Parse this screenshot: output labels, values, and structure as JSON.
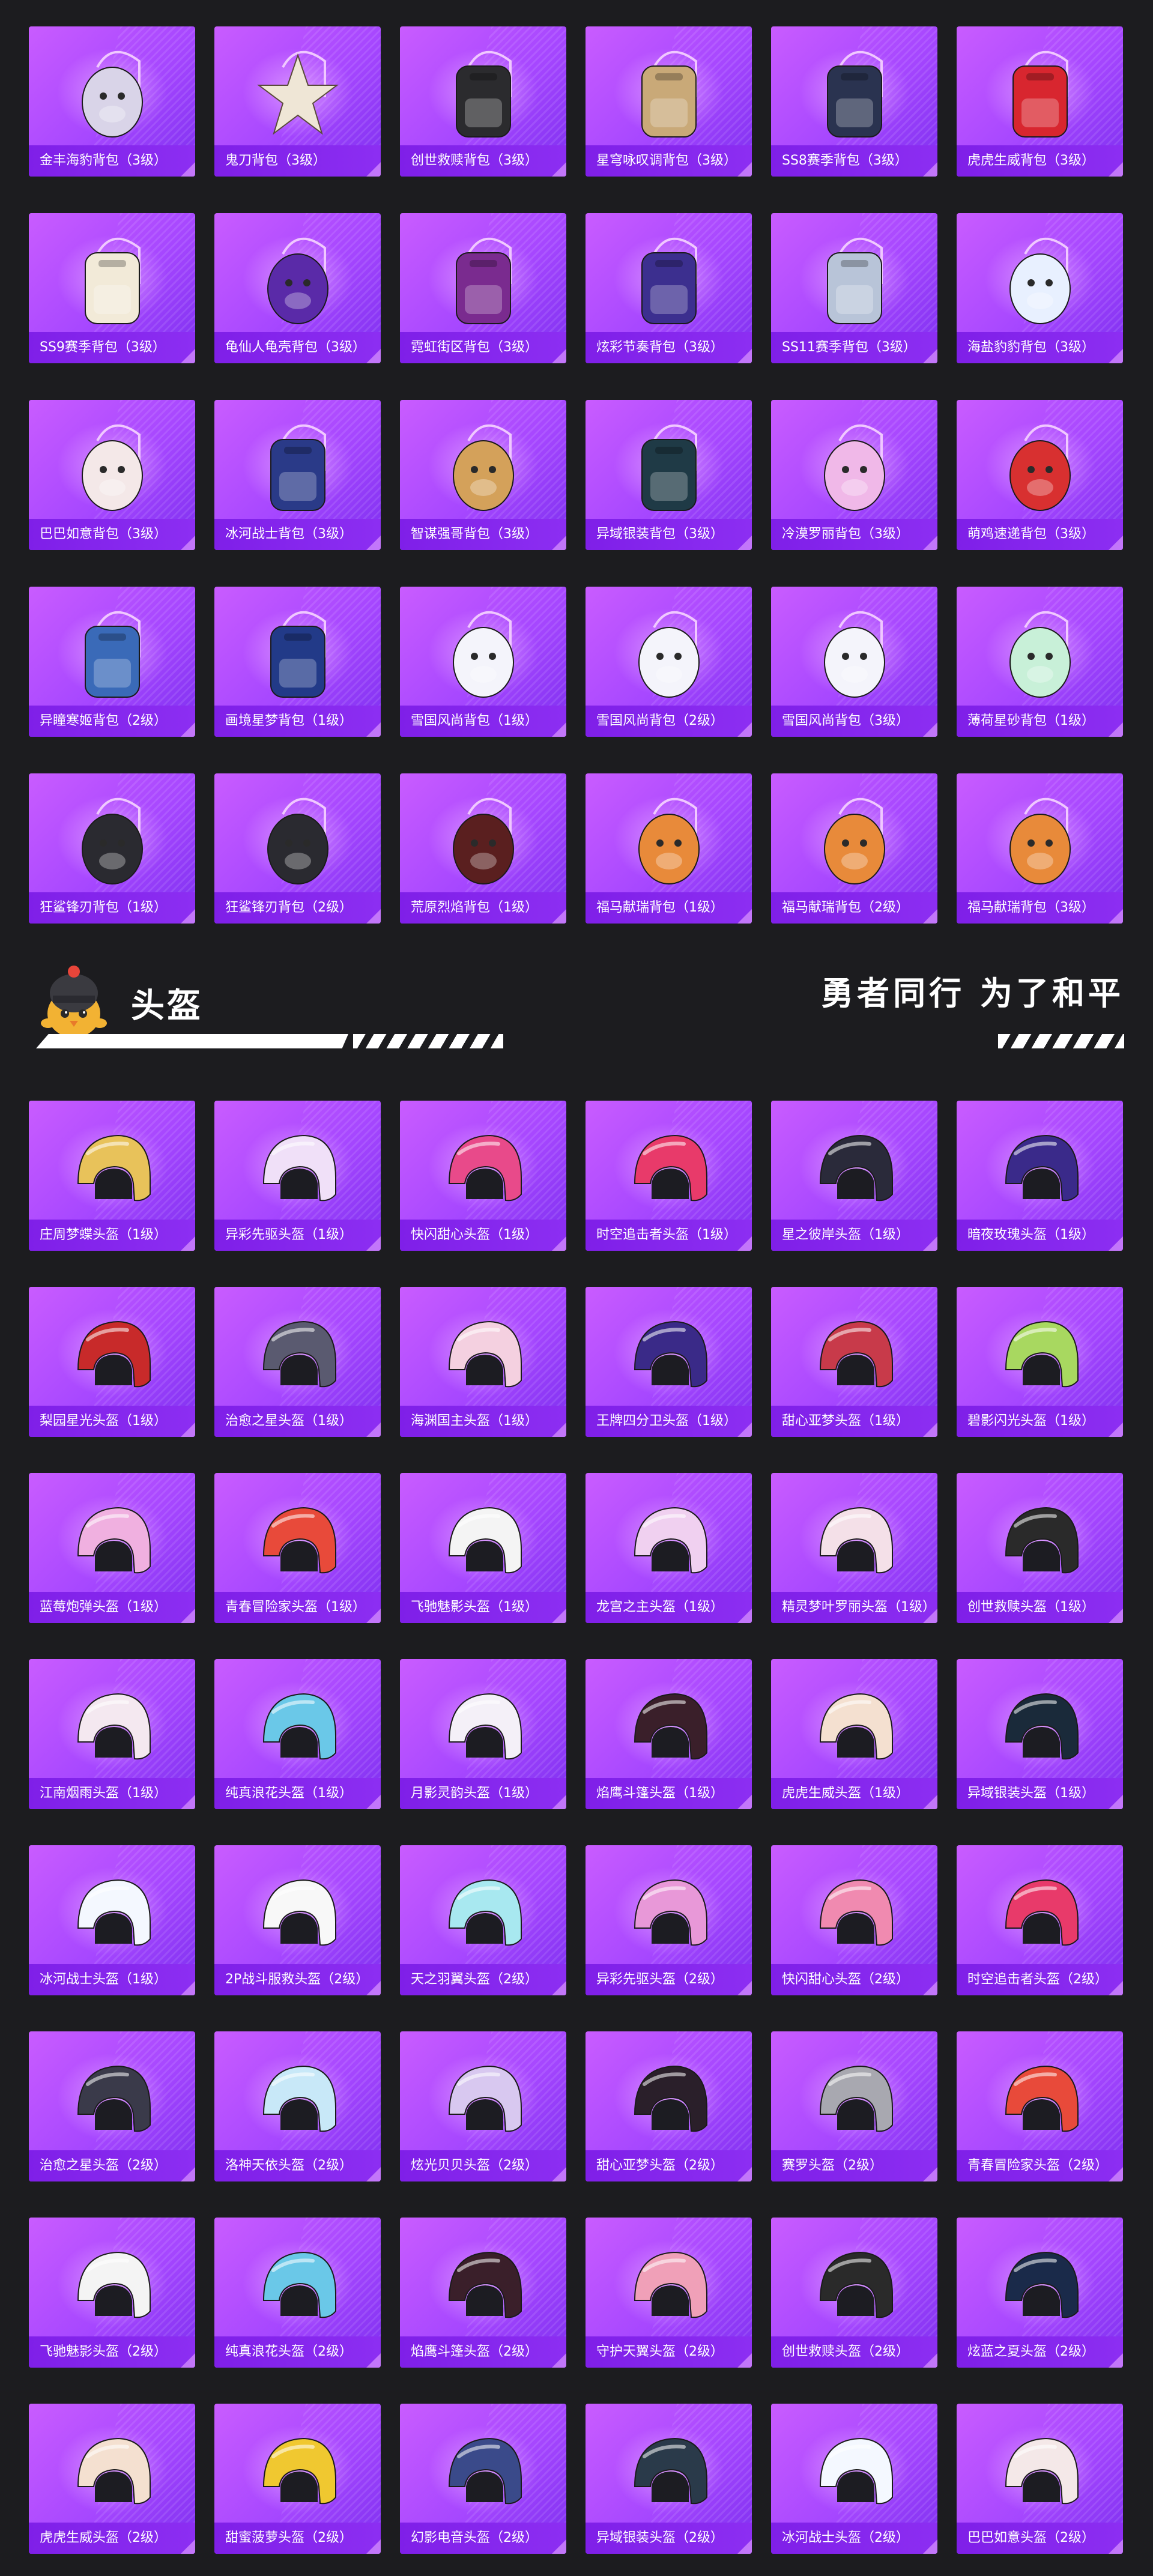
{
  "colors": {
    "background": "#1c1c1f",
    "card_gradient_start": "#c95cff",
    "card_gradient_end": "#7d2ff0",
    "label_bar": "#7f1fe8",
    "text": "#ffffff"
  },
  "backpacks": [
    {
      "name": "金丰海豹背包（3级）",
      "icon": "seal-backpack-icon",
      "shape": "round",
      "color": "#d9d4e8"
    },
    {
      "name": "鬼刀背包（3级）",
      "icon": "blade-backpack-icon",
      "shape": "star",
      "color": "#efe6d6"
    },
    {
      "name": "创世救赎背包（3级）",
      "icon": "armor-backpack-icon",
      "shape": "tactical",
      "color": "#2b2b2e"
    },
    {
      "name": "星穹咏叹调背包（3级）",
      "icon": "ornate-backpack-icon",
      "shape": "tactical",
      "color": "#c9a978"
    },
    {
      "name": "SS8赛季背包（3级）",
      "icon": "season-backpack-icon",
      "shape": "tactical",
      "color": "#2a3350"
    },
    {
      "name": "虎虎生威背包（3级）",
      "icon": "tiger-backpack-icon",
      "shape": "tactical",
      "color": "#d8262f"
    },
    {
      "name": "SS9赛季背包（3级）",
      "icon": "season-backpack-icon",
      "shape": "tactical",
      "color": "#f2ead8"
    },
    {
      "name": "龟仙人龟壳背包（3级）",
      "icon": "turtle-shell-backpack-icon",
      "shape": "round",
      "color": "#5a2aa8"
    },
    {
      "name": "霓虹街区背包（3级）",
      "icon": "neon-backpack-icon",
      "shape": "tactical",
      "color": "#7a2b8f"
    },
    {
      "name": "炫彩节奏背包（3级）",
      "icon": "rhythm-backpack-icon",
      "shape": "tactical",
      "color": "#3c2f8f"
    },
    {
      "name": "SS11赛季背包（3级）",
      "icon": "season-backpack-icon",
      "shape": "tactical",
      "color": "#b8c4d8"
    },
    {
      "name": "海盐豹豹背包（3级）",
      "icon": "seal-backpack-icon",
      "shape": "round",
      "color": "#e8f0ff"
    },
    {
      "name": "巴巴如意背包（3级）",
      "icon": "rabbit-backpack-icon",
      "shape": "round",
      "color": "#f4e8e8"
    },
    {
      "name": "冰河战士背包（3级）",
      "icon": "warrior-backpack-icon",
      "shape": "tactical",
      "color": "#2a3a88"
    },
    {
      "name": "智谋强哥背包（3级）",
      "icon": "bear-backpack-icon",
      "shape": "round",
      "color": "#d4a15a"
    },
    {
      "name": "异域银装背包（3级）",
      "icon": "exotic-backpack-icon",
      "shape": "tactical",
      "color": "#1f3a46"
    },
    {
      "name": "冷漠罗丽背包（3级）",
      "icon": "heart-backpack-icon",
      "shape": "round",
      "color": "#f0b8e8"
    },
    {
      "name": "萌鸡速递背包（3级）",
      "icon": "chick-backpack-icon",
      "shape": "round",
      "color": "#d83030"
    },
    {
      "name": "异瞳寒姬背包（2级）",
      "icon": "ice-backpack-icon",
      "shape": "tactical",
      "color": "#3a6ab8"
    },
    {
      "name": "画境星梦背包（1级）",
      "icon": "book-backpack-icon",
      "shape": "tactical",
      "color": "#223a88"
    },
    {
      "name": "雪国风尚背包（1级）",
      "icon": "snow-bunny-backpack-icon",
      "shape": "round",
      "color": "#f4f4fb"
    },
    {
      "name": "雪国风尚背包（2级）",
      "icon": "snow-bunny-backpack-icon",
      "shape": "round",
      "color": "#f4f4fb"
    },
    {
      "name": "雪国风尚背包（3级）",
      "icon": "snow-bunny-backpack-icon",
      "shape": "round",
      "color": "#f4f4fb"
    },
    {
      "name": "薄荷星砂背包（1级）",
      "icon": "mint-backpack-icon",
      "shape": "round",
      "color": "#c8f0d8"
    },
    {
      "name": "狂鲨锋刃背包（1级）",
      "icon": "shark-backpack-icon",
      "shape": "round",
      "color": "#2a2a30"
    },
    {
      "name": "狂鲨锋刃背包（2级）",
      "icon": "shark-backpack-icon",
      "shape": "round",
      "color": "#2a2a30"
    },
    {
      "name": "荒原烈焰背包（1级）",
      "icon": "flame-backpack-icon",
      "shape": "round",
      "color": "#5a1f1f"
    },
    {
      "name": "福马献瑞背包（1级）",
      "icon": "horse-backpack-icon",
      "shape": "round",
      "color": "#e88a3a"
    },
    {
      "name": "福马献瑞背包（2级）",
      "icon": "horse-backpack-icon",
      "shape": "round",
      "color": "#e88a3a"
    },
    {
      "name": "福马献瑞背包（3级）",
      "icon": "horse-backpack-icon",
      "shape": "round",
      "color": "#e88a3a"
    }
  ],
  "section": {
    "title": "头盔",
    "slogan": "勇者同行 为了和平",
    "mascot_icon": "chick-helmet-mascot-icon"
  },
  "helmets": [
    {
      "name": "庄周梦蝶头盔（1级）",
      "icon": "helmet-icon",
      "color": "#e8c25a"
    },
    {
      "name": "异彩先驱头盔（1级）",
      "icon": "helmet-icon",
      "color": "#f0e0f8"
    },
    {
      "name": "快闪甜心头盔（1级）",
      "icon": "helmet-icon",
      "color": "#e84a8a"
    },
    {
      "name": "时空追击者头盔（1级）",
      "icon": "helmet-icon",
      "color": "#e83a6a"
    },
    {
      "name": "星之彼岸头盔（1级）",
      "icon": "helmet-icon",
      "color": "#2a2a3a"
    },
    {
      "name": "暗夜玫瑰头盔（1级）",
      "icon": "helmet-icon",
      "color": "#3a2a8a"
    },
    {
      "name": "梨园星光头盔（1级）",
      "icon": "helmet-icon",
      "color": "#c82a2a"
    },
    {
      "name": "治愈之星头盔（1级）",
      "icon": "helmet-icon",
      "color": "#5a5a70"
    },
    {
      "name": "海渊国主头盔（1级）",
      "icon": "helmet-icon",
      "color": "#f4d0e0"
    },
    {
      "name": "王牌四分卫头盔（1级）",
      "icon": "helmet-icon",
      "color": "#3a2a88"
    },
    {
      "name": "甜心亚梦头盔（1级）",
      "icon": "helmet-icon",
      "color": "#c83a4a"
    },
    {
      "name": "碧影闪光头盔（1级）",
      "icon": "helmet-icon",
      "color": "#a8d860"
    },
    {
      "name": "蓝莓炮弹头盔（1级）",
      "icon": "helmet-icon",
      "color": "#f0b0e0"
    },
    {
      "name": "青春冒险家头盔（1级）",
      "icon": "helmet-icon",
      "color": "#e84a3a"
    },
    {
      "name": "飞驰魅影头盔（1级）",
      "icon": "helmet-icon",
      "color": "#f4f4f4"
    },
    {
      "name": "龙宫之主头盔（1级）",
      "icon": "helmet-icon",
      "color": "#f0d0f0"
    },
    {
      "name": "精灵梦叶罗丽头盔（1级）",
      "icon": "helmet-icon",
      "color": "#f4e0e8"
    },
    {
      "name": "创世救赎头盔（1级）",
      "icon": "helmet-icon",
      "color": "#2a2a2a"
    },
    {
      "name": "江南烟雨头盔（1级）",
      "icon": "helmet-icon",
      "color": "#f4e8f0"
    },
    {
      "name": "纯真浪花头盔（1级）",
      "icon": "helmet-icon",
      "color": "#6ac8e8"
    },
    {
      "name": "月影灵韵头盔（1级）",
      "icon": "helmet-icon",
      "color": "#f4f0f8"
    },
    {
      "name": "焰鹰斗篷头盔（1级）",
      "icon": "helmet-icon",
      "color": "#3a1f2a"
    },
    {
      "name": "虎虎生威头盔（1级）",
      "icon": "helmet-icon",
      "color": "#f4e0d0"
    },
    {
      "name": "异域银装头盔（1级）",
      "icon": "helmet-icon",
      "color": "#1a2a3a"
    },
    {
      "name": "冰河战士头盔（1级）",
      "icon": "helmet-icon",
      "color": "#f4f8ff"
    },
    {
      "name": "2P战斗服救头盔（2级）",
      "icon": "helmet-icon",
      "color": "#f8f8f8"
    },
    {
      "name": "天之羽翼头盔（2级）",
      "icon": "helmet-icon",
      "color": "#a8e8f0"
    },
    {
      "name": "异彩先驱头盔（2级）",
      "icon": "helmet-icon",
      "color": "#e898d8"
    },
    {
      "name": "快闪甜心头盔（2级）",
      "icon": "helmet-icon",
      "color": "#f08ab0"
    },
    {
      "name": "时空追击者头盔（2级）",
      "icon": "helmet-icon",
      "color": "#e83a6a"
    },
    {
      "name": "治愈之星头盔（2级）",
      "icon": "helmet-icon",
      "color": "#3a3a4a"
    },
    {
      "name": "洛神天依头盔（2级）",
      "icon": "helmet-icon",
      "color": "#c8e8f8"
    },
    {
      "name": "炫光贝贝头盔（2级）",
      "icon": "helmet-icon",
      "color": "#d8c8f0"
    },
    {
      "name": "甜心亚梦头盔（2级）",
      "icon": "helmet-icon",
      "color": "#2a1f2a"
    },
    {
      "name": "赛罗头盔（2级）",
      "icon": "helmet-icon",
      "color": "#a8a8b0"
    },
    {
      "name": "青春冒险家头盔（2级）",
      "icon": "helmet-icon",
      "color": "#e84a3a"
    },
    {
      "name": "飞驰魅影头盔（2级）",
      "icon": "helmet-icon",
      "color": "#f4f4f4"
    },
    {
      "name": "纯真浪花头盔（2级）",
      "icon": "helmet-icon",
      "color": "#6ac8e8"
    },
    {
      "name": "焰鹰斗篷头盔（2级）",
      "icon": "helmet-icon",
      "color": "#3a1f2a"
    },
    {
      "name": "守护天翼头盔（2级）",
      "icon": "helmet-icon",
      "color": "#f0a0b8"
    },
    {
      "name": "创世救赎头盔（2级）",
      "icon": "helmet-icon",
      "color": "#2a2a2a"
    },
    {
      "name": "炫蓝之夏头盔（2级）",
      "icon": "helmet-icon",
      "color": "#1a2a4a"
    },
    {
      "name": "虎虎生威头盔（2级）",
      "icon": "helmet-icon",
      "color": "#f4e0d0"
    },
    {
      "name": "甜蜜菠萝头盔（2级）",
      "icon": "helmet-icon",
      "color": "#f0c830"
    },
    {
      "name": "幻影电音头盔（2级）",
      "icon": "helmet-icon",
      "color": "#3a4a8a"
    },
    {
      "name": "异域银装头盔（2级）",
      "icon": "helmet-icon",
      "color": "#2a3a4a"
    },
    {
      "name": "冰河战士头盔（2级）",
      "icon": "helmet-icon",
      "color": "#f4f8ff"
    },
    {
      "name": "巴巴如意头盔（2级）",
      "icon": "helmet-icon",
      "color": "#f4e8e8"
    }
  ]
}
